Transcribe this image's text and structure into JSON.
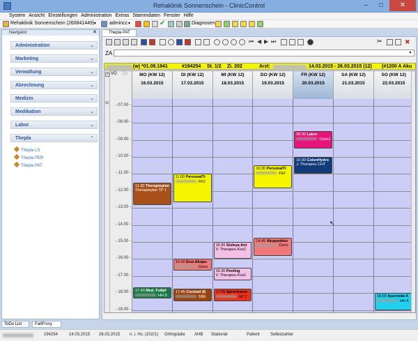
{
  "window": {
    "title": "Rehaklinik Sonnenschein - ClinicControl",
    "minimize": "–",
    "maximize": "□",
    "close": "✕"
  },
  "menu": [
    "System",
    "Ansicht",
    "Einstellungen",
    "Administration",
    "Extras",
    "Stammdaten",
    "Fenster",
    "Hilfe"
  ],
  "toolbar": {
    "clinic": "Rehaklinik Sonnenschein (260841449)",
    "user": "admincc",
    "diagnosen": "Diagnosen"
  },
  "navigator": {
    "title": "Navigator",
    "groups": [
      "Administration",
      "Marketing",
      "Verwaltung",
      "Abrechnung",
      "Medizin",
      "Medikation",
      "Labor",
      "Thepla"
    ],
    "items": [
      "Thepla LS",
      "Thepla PER",
      "Thepla PAT"
    ]
  },
  "tab": {
    "label": "Thepla PAT"
  },
  "za": {
    "label": "ZA"
  },
  "patient": {
    "dob": "(w) *01.09.1941",
    "id": "#194254",
    "st": "St. 1/2",
    "zi": "Zi. 202",
    "arzt": "Arzt:",
    "range": "14.03.2015 - 26.03.2015 (12)",
    "code": "(#1200 A Aku"
  },
  "calendar": {
    "vo_label": "VO",
    "ep_label": "Ep",
    "days": [
      {
        "name": "MO",
        "kw": "(KW 12)",
        "date": "16.03.2015"
      },
      {
        "name": "DI",
        "kw": "(KW 12)",
        "date": "17.03.2015"
      },
      {
        "name": "MI",
        "kw": "(KW 12)",
        "date": "18.03.2015"
      },
      {
        "name": "DO",
        "kw": "(KW 12)",
        "date": "19.03.2015"
      },
      {
        "name": "FR",
        "kw": "(KW 12)",
        "date": "20.03.2015"
      },
      {
        "name": "SA",
        "kw": "(KW 12)",
        "date": "21.03.2015"
      },
      {
        "name": "SO",
        "kw": "(KW 12)",
        "date": "22.03.2015"
      }
    ],
    "times": [
      "07.00",
      "08.00",
      "09.00",
      "10.00",
      "11.00",
      "12.00",
      "13.00",
      "14.00",
      "15.00",
      "16.00",
      "17.00",
      "18.00",
      "19.00"
    ],
    "appointments": [
      {
        "day": 0,
        "start": 11.5,
        "end": 12.83,
        "time": "11.30",
        "title": "Therapieplan",
        "sub": "Therapieplan TP 1",
        "bg": "#a8501a",
        "fg": "#ffffff"
      },
      {
        "day": 0,
        "start": 17.67,
        "end": 18.33,
        "time": "17.40",
        "title": "Med. Fußpf",
        "sub": "",
        "room": "HH 9",
        "bg": "#1a7a45",
        "fg": "#ffffff"
      },
      {
        "day": 1,
        "start": 11.0,
        "end": 12.67,
        "time": "11.00",
        "title": "PersonalTr",
        "sub": "",
        "room": "FK2",
        "bg": "#f5f500",
        "fg": "#000000"
      },
      {
        "day": 1,
        "start": 16.0,
        "end": 16.67,
        "time": "16.00",
        "title": "Erst-Akupu",
        "sub": "",
        "room": "Ozon",
        "bg": "#f07878",
        "fg": "#000000"
      },
      {
        "day": 1,
        "start": 17.75,
        "end": 18.5,
        "time": "17.45",
        "title": "Cocktail (E",
        "sub": "",
        "room": "SBE",
        "bg": "#9a4410",
        "fg": "#ffffff"
      },
      {
        "day": 2,
        "start": 15.0,
        "end": 16.0,
        "time": "15.00",
        "title": "Sisleya Ant",
        "sub": "V. Therapeu Kos1",
        "bg": "#f5c0e8",
        "fg": "#000000"
      },
      {
        "day": 2,
        "start": 16.5,
        "end": 17.25,
        "time": "16.30",
        "title": "Peeling",
        "sub": "V. Therapeu Kos1",
        "bg": "#f5c0e8",
        "fg": "#000000"
      },
      {
        "day": 2,
        "start": 17.75,
        "end": 18.5,
        "time": "17.45",
        "title": "Sprechstun",
        "sub": "",
        "room": "AZ 2",
        "bg": "#e8321c",
        "fg": "#000000"
      },
      {
        "day": 3,
        "start": 10.5,
        "end": 11.83,
        "time": "10.30",
        "title": "PersonalTr",
        "sub": "",
        "room": "Fk2",
        "bg": "#f5f500",
        "fg": "#000000"
      },
      {
        "day": 3,
        "start": 14.75,
        "end": 15.83,
        "time": "14.45",
        "title": "Akupunktur",
        "sub": "",
        "room": "Ozon",
        "bg": "#f07878",
        "fg": "#000000"
      },
      {
        "day": 4,
        "start": 8.5,
        "end": 9.5,
        "time": "08.30",
        "title": "Labor",
        "sub": "",
        "room": "Ozon2",
        "bg": "#e8147a",
        "fg": "#ffffff"
      },
      {
        "day": 4,
        "start": 10.0,
        "end": 11.0,
        "time": "10.00",
        "title": "ColonHydro",
        "sub": "J. Therapeu CHT",
        "bg": "#103a78",
        "fg": "#ffffff"
      },
      {
        "day": 6,
        "start": 18.0,
        "end": 19.0,
        "time": "18.00",
        "title": "Ayurveda K",
        "sub": "",
        "room": "HH 4",
        "bg": "#20d0ee",
        "fg": "#000000"
      }
    ]
  },
  "bottom_tabs": [
    "ToDo List",
    "FallProxy"
  ],
  "status": [
    "194254",
    "14.03.2015",
    "26.03.2015",
    "n. i. Hs. (202/1)",
    "Orthopädie",
    "AHB",
    "Stationär",
    "Patient",
    "Selbstzahler"
  ]
}
